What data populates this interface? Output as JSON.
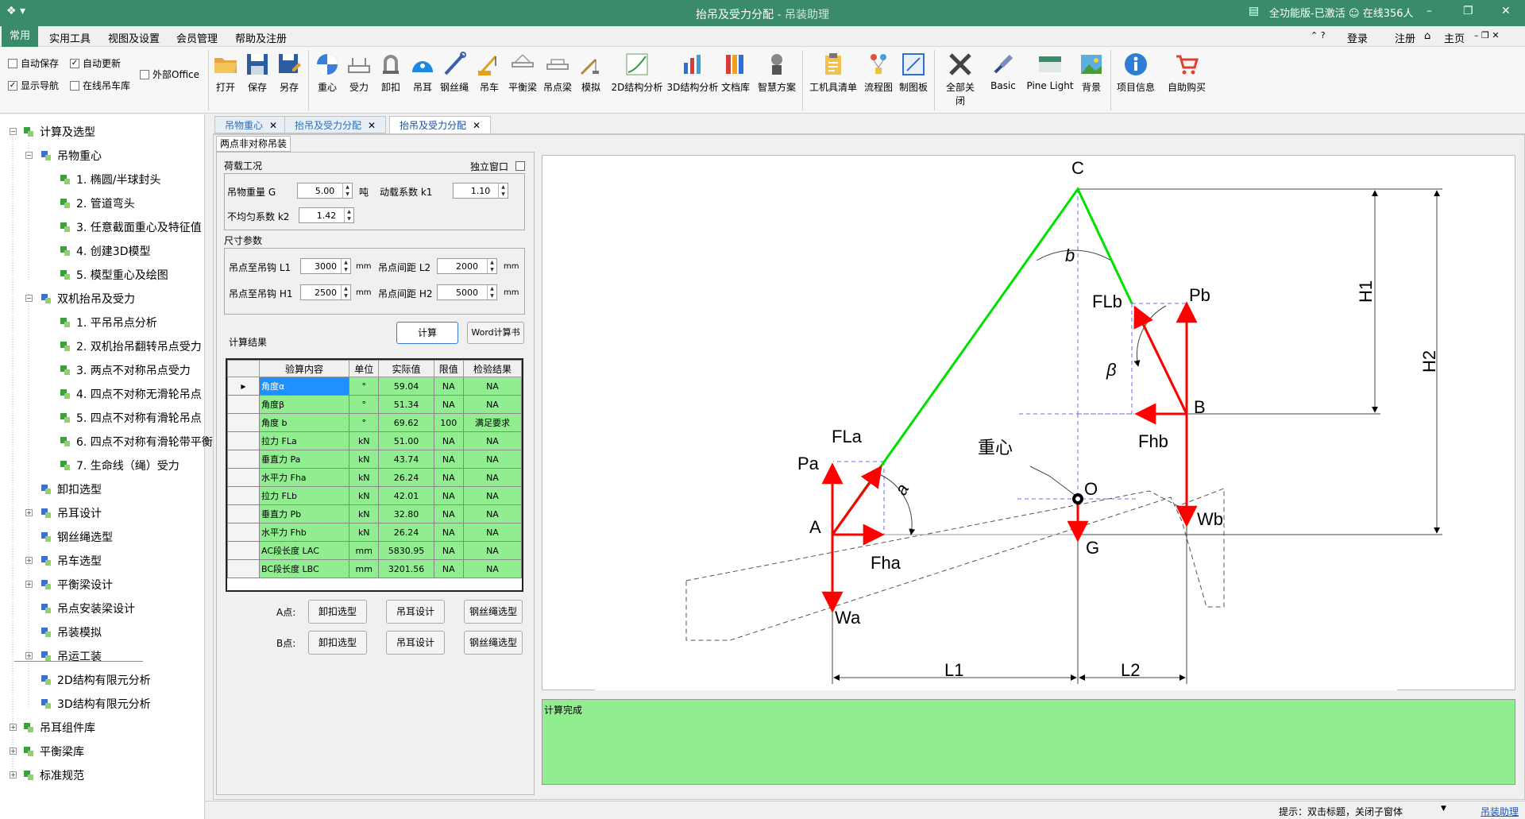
{
  "app": {
    "title": "抬吊及受力分配",
    "subtitle": " - 吊装助理",
    "edition": "全功能版-已激活",
    "online": "在线356人"
  },
  "menu": {
    "items": [
      "常用",
      "实用工具",
      "视图及设置",
      "会员管理",
      "帮助及注册"
    ],
    "right": [
      "登录",
      "注册",
      "主页"
    ]
  },
  "ribbon": {
    "checks": [
      {
        "label": "自动保存",
        "checked": false
      },
      {
        "label": "自动更新",
        "checked": true
      },
      {
        "label": "外部Office",
        "checked": false
      },
      {
        "label": "显示导航",
        "checked": true
      },
      {
        "label": "在线吊车库",
        "checked": false
      }
    ],
    "buttons": [
      "打开",
      "保存",
      "另存",
      "重心",
      "受力",
      "卸扣",
      "吊耳",
      "钢丝绳",
      "吊车",
      "平衡梁",
      "吊点梁",
      "模拟",
      "2D结构分析",
      "3D结构分析",
      "文档库",
      "智慧方案",
      "工机具清单",
      "流程图",
      "制图板",
      "全部关闭",
      "Basic",
      "Pine Light",
      "背景",
      "项目信息",
      "自助购买"
    ]
  },
  "tree": {
    "items": [
      "计算及选型",
      "吊物重心",
      "1. 椭圆/半球封头",
      "2. 管道弯头",
      "3. 任意截面重心及特征值",
      "4. 创建3D模型",
      "5. 模型重心及绘图",
      "双机抬吊及受力",
      "1. 平吊吊点分析",
      "2. 双机抬吊翻转吊点受力",
      "3. 两点不对称吊点受力",
      "4. 四点不对称无滑轮吊点",
      "5. 四点不对称有滑轮吊点",
      "6. 四点不对称有滑轮带平衡梁",
      "7. 生命线（绳）受力",
      "卸扣选型",
      "吊耳设计",
      "钢丝绳选型",
      "吊车选型",
      "平衡梁设计",
      "吊点安装梁设计",
      "吊装模拟",
      "吊运工装",
      "2D结构有限元分析",
      "3D结构有限元分析",
      "吊耳组件库",
      "平衡梁库",
      "标准规范"
    ]
  },
  "doc_tabs": [
    "吊物重心",
    "抬吊及受力分配",
    "抬吊及受力分配"
  ],
  "sheet_tab": "两点非对称吊装",
  "load": {
    "title": "荷载工况",
    "independent": "独立窗口",
    "weight_label": "吊物重量 G",
    "weight": "5.00",
    "weight_unit": "吨",
    "dyn_label": "动载系数 k1",
    "dyn": "1.10",
    "uneven_label": "不均匀系数 k2",
    "uneven": "1.42"
  },
  "dims": {
    "title": "尺寸参数",
    "l1_label": "吊点至吊钩 L1",
    "l1": "3000",
    "l2_label": "吊点间距 L2",
    "l2": "2000",
    "h1_label": "吊点至吊钩 H1",
    "h1": "2500",
    "h2_label": "吊点间距 H2",
    "h2": "5000",
    "unit": "mm"
  },
  "actions": {
    "calc": "计算",
    "word": "Word计算书",
    "results_label": "计算结果"
  },
  "results": {
    "headers": [
      "验算内容",
      "单位",
      "实际值",
      "限值",
      "检验结果"
    ],
    "rows": [
      [
        "角度α",
        "°",
        "59.04",
        "NA",
        "NA"
      ],
      [
        "角度β",
        "°",
        "51.34",
        "NA",
        "NA"
      ],
      [
        "角度 b",
        "°",
        "69.62",
        "100",
        "满足要求"
      ],
      [
        "拉力 FLa",
        "kN",
        "51.00",
        "NA",
        "NA"
      ],
      [
        "垂直力 Pa",
        "kN",
        "43.74",
        "NA",
        "NA"
      ],
      [
        "水平力 Fha",
        "kN",
        "26.24",
        "NA",
        "NA"
      ],
      [
        "拉力 FLb",
        "kN",
        "42.01",
        "NA",
        "NA"
      ],
      [
        "垂直力 Pb",
        "kN",
        "32.80",
        "NA",
        "NA"
      ],
      [
        "水平力 Fhb",
        "kN",
        "26.24",
        "NA",
        "NA"
      ],
      [
        "AC段长度 LAC",
        "mm",
        "5830.95",
        "NA",
        "NA"
      ],
      [
        "BC段长度 LBC",
        "mm",
        "3201.56",
        "NA",
        "NA"
      ]
    ]
  },
  "point_a": {
    "label": "A点:",
    "b1": "卸扣选型",
    "b2": "吊耳设计",
    "b3": "钢丝绳选型"
  },
  "point_b": {
    "label": "B点:",
    "b1": "卸扣选型",
    "b2": "吊耳设计",
    "b3": "钢丝绳选型"
  },
  "diagram": {
    "labels": [
      "C",
      "b",
      "FLb",
      "Pb",
      "H1",
      "H2",
      "β",
      "B",
      "Fhb",
      "重心",
      "O",
      "FLa",
      "Pa",
      "a",
      "A",
      "Fha",
      "G",
      "Wb",
      "Wa",
      "L1",
      "L2"
    ]
  },
  "status": {
    "text": "计算完成"
  },
  "footer": {
    "hint": "提示：双击标题，关闭子窗体",
    "link": "吊装助理"
  },
  "colors": {
    "accent": "#3a8b69",
    "result_green": "#90ee90",
    "force_red": "#ff0000",
    "rope_green": "#00e000",
    "rope_brown": "#a0522d"
  }
}
